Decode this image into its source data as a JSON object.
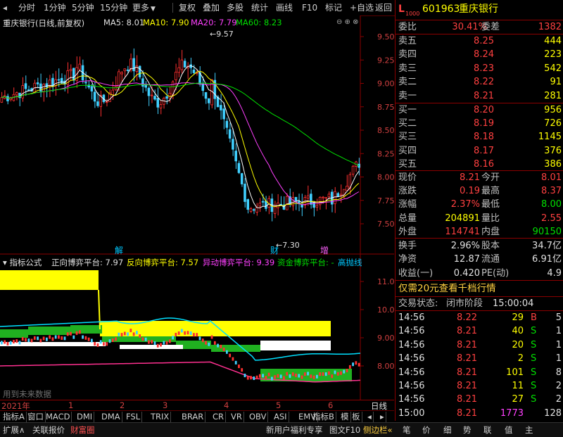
{
  "toolbar": {
    "items": [
      "分时",
      "1分钟",
      "5分钟",
      "15分钟",
      "更多",
      "复权",
      "叠加",
      "多股",
      "统计",
      "画线",
      "F10",
      "标记",
      "+自选",
      "返回"
    ]
  },
  "main_chart": {
    "title": "重庆银行(日线,前复权)",
    "ma5": "MA5: 8.01",
    "ma10": "MA10: 7.90",
    "ma20": "MA20: 7.79",
    "ma60": "MA60: 8.23",
    "high_mark": "9.57",
    "low_mark": "7.30",
    "y_ticks": [
      "9.50",
      "9.25",
      "9.00",
      "8.75",
      "8.50",
      "8.25",
      "8.00",
      "7.75",
      "7.50"
    ],
    "events": [
      "解",
      "财",
      "增"
    ]
  },
  "indicator": {
    "name": "指标公式",
    "l1": "正向博弈平台: 7.97",
    "l2": "反向博弈平台: 7.57",
    "l3": "异动博弈平台: 9.39",
    "l4": "资金博弈平台: -",
    "l5": "高抛线",
    "y_ticks": [
      "11.00",
      "10.00",
      "9.00",
      "8.00"
    ],
    "watermark": "用到未来数据"
  },
  "x_axis": {
    "labels": [
      "2021年",
      "1",
      "2",
      "3",
      "4",
      "5",
      "6"
    ],
    "right_label": "日线"
  },
  "tabs": [
    "指标A",
    "窗口",
    "MACD",
    "DMI",
    "DMA",
    "FSL",
    "TRIX",
    "BRAR",
    "CR",
    "VR",
    "OBV",
    "ASI",
    "EMV",
    "指标B",
    "模",
    "板"
  ],
  "statusbar": {
    "items": [
      "扩展∧",
      "关联报价",
      "财富圈"
    ],
    "right_items": [
      "新用户福利专享",
      "图文F10",
      "侧边栏«"
    ],
    "icons": [
      "笔",
      "价",
      "细",
      "势",
      "联",
      "值",
      "主"
    ]
  },
  "quote": {
    "code": "601963",
    "name": "重庆银行",
    "weibi_label": "委比",
    "weibi": "30.41%",
    "weicha_label": "委差",
    "weicha": "1382",
    "sells": [
      {
        "label": "卖五",
        "price": "8.25",
        "vol": "444"
      },
      {
        "label": "卖四",
        "price": "8.24",
        "vol": "223"
      },
      {
        "label": "卖三",
        "price": "8.23",
        "vol": "542"
      },
      {
        "label": "卖二",
        "price": "8.22",
        "vol": "91"
      },
      {
        "label": "卖一",
        "price": "8.21",
        "vol": "281"
      }
    ],
    "buys": [
      {
        "label": "买一",
        "price": "8.20",
        "vol": "956"
      },
      {
        "label": "买二",
        "price": "8.19",
        "vol": "726"
      },
      {
        "label": "买三",
        "price": "8.18",
        "vol": "1145"
      },
      {
        "label": "买四",
        "price": "8.17",
        "vol": "376"
      },
      {
        "label": "买五",
        "price": "8.16",
        "vol": "386"
      }
    ],
    "stats": [
      {
        "l1": "现价",
        "v1": "8.21",
        "l2": "今开",
        "v2": "8.01",
        "c1": "red",
        "c2": "red"
      },
      {
        "l1": "涨跌",
        "v1": "0.19",
        "l2": "最高",
        "v2": "8.37",
        "c1": "red",
        "c2": "red"
      },
      {
        "l1": "涨幅",
        "v1": "2.37%",
        "l2": "最低",
        "v2": "8.00",
        "c1": "red",
        "c2": "green"
      },
      {
        "l1": "总量",
        "v1": "204891",
        "l2": "量比",
        "v2": "2.55",
        "c1": "yellow",
        "c2": "red"
      },
      {
        "l1": "外盘",
        "v1": "114741",
        "l2": "内盘",
        "v2": "90150",
        "c1": "red",
        "c2": "green"
      }
    ],
    "stats2": [
      {
        "l1": "换手",
        "v1": "2.96%",
        "l2": "股本",
        "v2": "34.7亿"
      },
      {
        "l1": "净资",
        "v1": "12.87",
        "l2": "流通",
        "v2": "6.91亿"
      },
      {
        "l1": "收益(一)",
        "v1": "0.420",
        "l2": "PE(动)",
        "v2": "4.9"
      }
    ],
    "promo": "仅需20元查看千档行情",
    "trade_status_label": "交易状态:",
    "trade_status": "闭市阶段",
    "trade_time": "15:00:04",
    "ticks": [
      {
        "t": "14:56",
        "p": "8.22",
        "v": "29",
        "d": "B",
        "n": "5"
      },
      {
        "t": "14:56",
        "p": "8.21",
        "v": "40",
        "d": "S",
        "n": "1"
      },
      {
        "t": "14:56",
        "p": "8.21",
        "v": "20",
        "d": "S",
        "n": "1"
      },
      {
        "t": "14:56",
        "p": "8.21",
        "v": "2",
        "d": "S",
        "n": "1"
      },
      {
        "t": "14:56",
        "p": "8.21",
        "v": "101",
        "d": "S",
        "n": "8"
      },
      {
        "t": "14:56",
        "p": "8.21",
        "v": "11",
        "d": "S",
        "n": "2"
      },
      {
        "t": "14:56",
        "p": "8.21",
        "v": "27",
        "d": "S",
        "n": "2"
      },
      {
        "t": "15:00",
        "p": "8.21",
        "v": "1773",
        "d": "",
        "n": "128"
      }
    ]
  }
}
